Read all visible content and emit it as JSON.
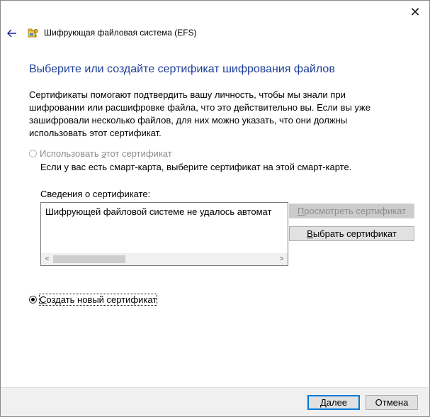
{
  "window": {
    "title": "Шифрующая файловая система (EFS)",
    "close_glyph": "✕",
    "back_glyph": "←"
  },
  "heading": "Выберите или создайте сертификат шифрования файлов",
  "description": "Сертификаты помогают подтвердить вашу личность, чтобы мы знали при шифровании или расшифровке файла, что это действительно вы. Если вы уже зашифровали несколько файлов, для них можно указать, что они должны использовать этот сертификат.",
  "use_existing": {
    "label_pre": "Использовать ",
    "label_accel": "э",
    "label_post": "тот сертификат",
    "selected": false,
    "enabled": false,
    "hint": "Если у вас есть смарт-карта, выберите сертификат на этой смарт-карте."
  },
  "certificate_info": {
    "label_pre": "Све",
    "label_accel": "д",
    "label_post": "ения о сертификате:",
    "text": "Шифрующей файловой системе не удалось автомат",
    "scroll_left": "<",
    "scroll_right": ">"
  },
  "buttons": {
    "view_pre": "",
    "view_accel": "П",
    "view_post": "росмотреть сертификат",
    "select_pre": "",
    "select_accel": "В",
    "select_post": "ыбрать сертификат",
    "next_pre": "",
    "next_accel": "Д",
    "next_post": "алее",
    "cancel": "Отмена"
  },
  "create_new": {
    "label_pre": "",
    "label_accel": "С",
    "label_post": "оздать новый сертификат",
    "selected": true
  },
  "colors": {
    "heading": "#1e3e97",
    "accent": "#0078d7",
    "disabled_text": "#8b8b8b"
  }
}
